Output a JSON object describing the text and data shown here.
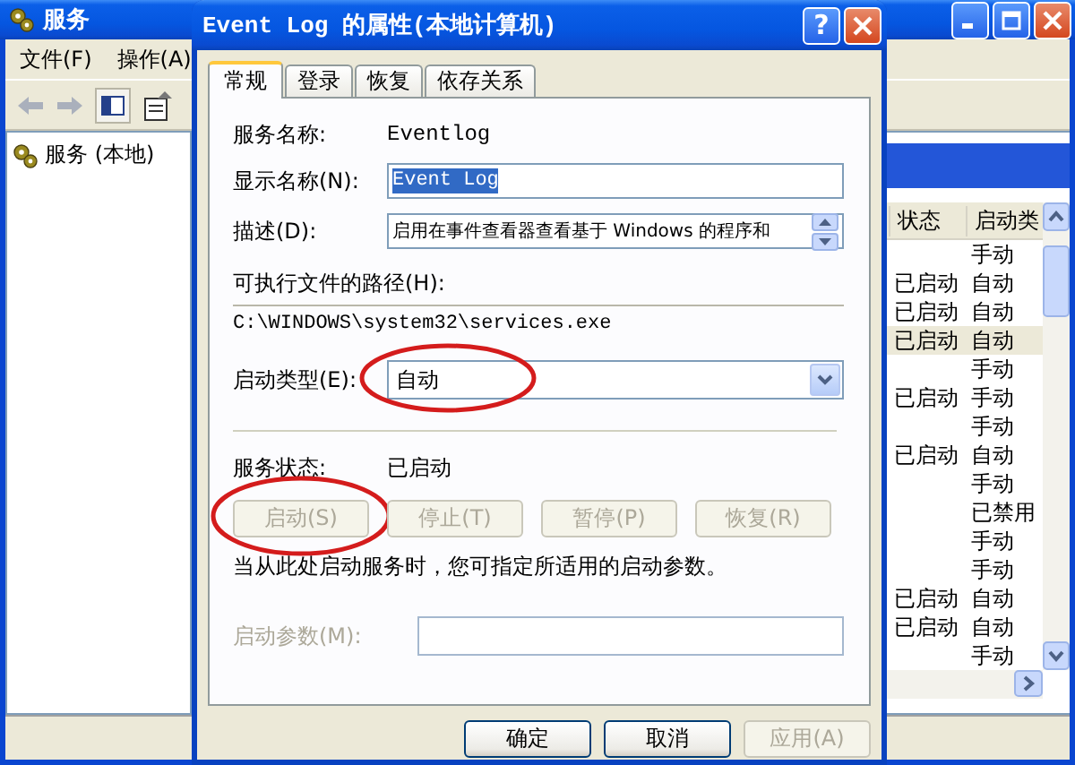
{
  "services_window": {
    "title": "服务",
    "menu": [
      "文件(F)",
      "操作(A)"
    ],
    "tree": [
      {
        "label": "服务 (本地)"
      }
    ],
    "columns": [
      "状态",
      "启动类"
    ],
    "rows": [
      {
        "startup": "手动",
        "selected": false
      },
      {
        "status": "已启动",
        "startup": "自动",
        "selected": false
      },
      {
        "status": "已启动",
        "startup": "自动",
        "selected": false
      },
      {
        "status": "已启动",
        "startup": "自动",
        "selected": true
      },
      {
        "startup": "手动",
        "selected": false
      },
      {
        "status": "已启动",
        "startup": "手动",
        "selected": false
      },
      {
        "startup": "手动",
        "selected": false
      },
      {
        "status": "已启动",
        "startup": "自动",
        "selected": false
      },
      {
        "startup": "手动",
        "selected": false
      },
      {
        "startup": "已禁用",
        "selected": false
      },
      {
        "startup": "手动",
        "selected": false
      },
      {
        "startup": "手动",
        "selected": false
      },
      {
        "status": "已启动",
        "startup": "自动",
        "selected": false
      },
      {
        "status": "已启动",
        "startup": "自动",
        "selected": false
      },
      {
        "startup": "手动",
        "selected": false
      }
    ]
  },
  "dialog": {
    "title": "Event Log 的属性(本地计算机)",
    "help_button": "?",
    "tabs": [
      {
        "label": "常规",
        "selected": true
      },
      {
        "label": "登录",
        "selected": false
      },
      {
        "label": "恢复",
        "selected": false
      },
      {
        "label": "依存关系",
        "selected": false
      }
    ],
    "service_name": {
      "label": "服务名称:",
      "value": "Eventlog"
    },
    "display_name": {
      "label": "显示名称(N):",
      "value": "Event Log",
      "highlighted": true
    },
    "description": {
      "label": "描述(D):",
      "value": "启用在事件查看器查看基于 Windows 的程序和"
    },
    "path": {
      "label": "可执行文件的路径(H):",
      "value": "C:\\WINDOWS\\system32\\services.exe"
    },
    "startup_type": {
      "label": "启动类型(E):",
      "value": "自动",
      "circled": true
    },
    "service_status": {
      "label": "服务状态:",
      "value": "已启动"
    },
    "control_buttons": [
      {
        "label": "启动(S)",
        "disabled": true,
        "circled": true
      },
      {
        "label": "停止(T)",
        "disabled": true,
        "circled": false
      },
      {
        "label": "暂停(P)",
        "disabled": true,
        "circled": false
      },
      {
        "label": "恢复(R)",
        "disabled": true,
        "circled": false
      }
    ],
    "hint": "当从此处启动服务时，您可指定所适用的启动参数。",
    "start_parameters": {
      "label": "启动参数(M):",
      "disabled": true
    },
    "buttons": [
      {
        "label": "确定",
        "disabled": false
      },
      {
        "label": "取消",
        "disabled": false
      },
      {
        "label": "应用(A)",
        "disabled": true
      }
    ]
  }
}
